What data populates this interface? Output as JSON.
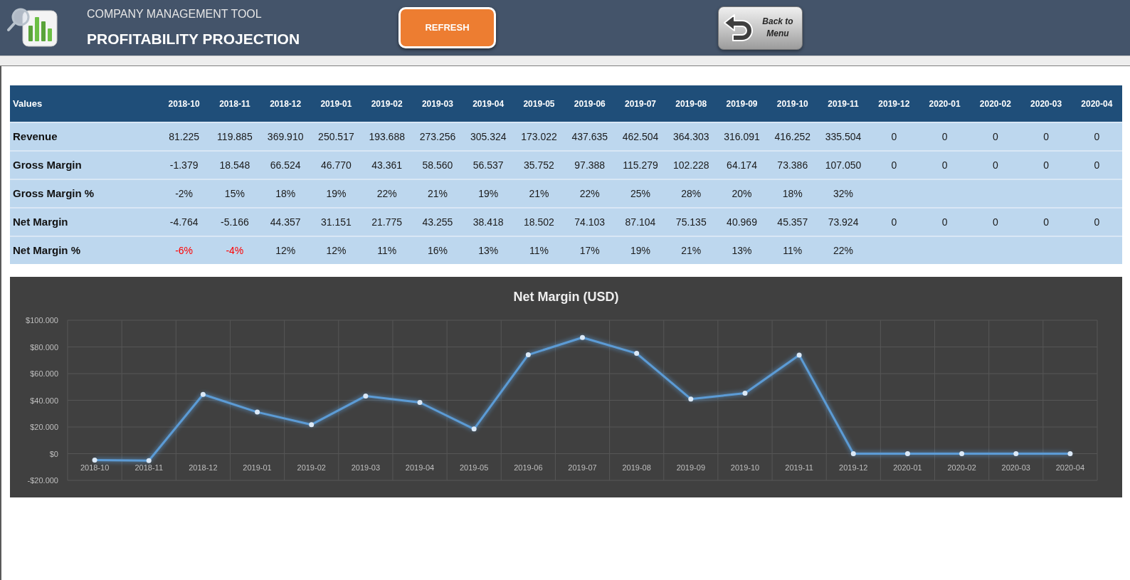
{
  "header": {
    "subtitle": "COMPANY MANAGEMENT TOOL",
    "title": "PROFITABILITY PROJECTION",
    "buttons": [
      {
        "label": "REFRESH",
        "kind": "primary"
      },
      {
        "label": "Back to Menu",
        "kind": "back"
      }
    ]
  },
  "table": {
    "label_header": "Values",
    "columns": [
      "2018-10",
      "2018-11",
      "2018-12",
      "2019-01",
      "2019-02",
      "2019-03",
      "2019-04",
      "2019-05",
      "2019-06",
      "2019-07",
      "2019-08",
      "2019-09",
      "2019-10",
      "2019-11",
      "2019-12",
      "2020-01",
      "2020-02",
      "2020-03",
      "2020-04"
    ],
    "rows": [
      {
        "label": "Revenue",
        "cells": [
          "81.225",
          "119.885",
          "369.910",
          "250.517",
          "193.688",
          "273.256",
          "305.324",
          "173.022",
          "437.635",
          "462.504",
          "364.303",
          "316.091",
          "416.252",
          "335.504",
          "0",
          "0",
          "0",
          "0",
          "0"
        ]
      },
      {
        "label": "Gross Margin",
        "cells": [
          "-1.379",
          "18.548",
          "66.524",
          "46.770",
          "43.361",
          "58.560",
          "56.537",
          "35.752",
          "97.388",
          "115.279",
          "102.228",
          "64.174",
          "73.386",
          "107.050",
          "0",
          "0",
          "0",
          "0",
          "0"
        ]
      },
      {
        "label": "Gross Margin %",
        "cells": [
          "-2%",
          "15%",
          "18%",
          "19%",
          "22%",
          "21%",
          "19%",
          "21%",
          "22%",
          "25%",
          "28%",
          "20%",
          "18%",
          "32%"
        ]
      },
      {
        "label": "Net Margin",
        "cells": [
          "-4.764",
          "-5.166",
          "44.357",
          "31.151",
          "21.775",
          "43.255",
          "38.418",
          "18.502",
          "74.103",
          "87.104",
          "75.135",
          "40.969",
          "45.357",
          "73.924",
          "0",
          "0",
          "0",
          "0",
          "0"
        ]
      },
      {
        "label": "Net Margin %",
        "cells": [
          {
            "text": "-6%",
            "alert": true
          },
          {
            "text": "-4%",
            "alert": true
          },
          {
            "text": "12%",
            "alert": false
          },
          {
            "text": "12%",
            "alert": false
          },
          {
            "text": "11%",
            "alert": false
          },
          {
            "text": "16%",
            "alert": false
          },
          {
            "text": "13%",
            "alert": false
          },
          {
            "text": "11%",
            "alert": false
          },
          {
            "text": "17%",
            "alert": false
          },
          {
            "text": "19%",
            "alert": false
          },
          {
            "text": "21%",
            "alert": false
          },
          {
            "text": "13%",
            "alert": false
          },
          {
            "text": "11%",
            "alert": false
          },
          {
            "text": "22%",
            "alert": false
          }
        ]
      }
    ]
  },
  "chart": {
    "chart_data": {
      "type": "line",
      "title": "Net Margin (USD)",
      "grid": true,
      "categories": [
        "2018-10",
        "2018-11",
        "2018-12",
        "2019-01",
        "2019-02",
        "2019-03",
        "2019-04",
        "2019-05",
        "2019-06",
        "2019-07",
        "2019-08",
        "2019-09",
        "2019-10",
        "2019-11",
        "2019-12",
        "2020-01",
        "2020-02",
        "2020-03",
        "2020-04"
      ],
      "series": [
        {
          "color": "#5b9bd5",
          "marker": true,
          "values": [
            -4764,
            -5166,
            44357,
            31151,
            21775,
            43255,
            38418,
            18502,
            74103,
            87104,
            75135,
            40969,
            45357,
            73924,
            0,
            0,
            0,
            0,
            0
          ]
        }
      ],
      "ylim": [
        -20000,
        100000
      ],
      "yticks": [
        {
          "value": 100000,
          "label": "$100.000"
        },
        {
          "value": 80000,
          "label": "$80.000"
        },
        {
          "value": 60000,
          "label": "$60.000"
        },
        {
          "value": 40000,
          "label": "$40.000"
        },
        {
          "value": 20000,
          "label": "$20.000"
        },
        {
          "value": 0,
          "label": "$0"
        },
        {
          "value": -20000,
          "label": "-$20.000"
        }
      ]
    }
  }
}
